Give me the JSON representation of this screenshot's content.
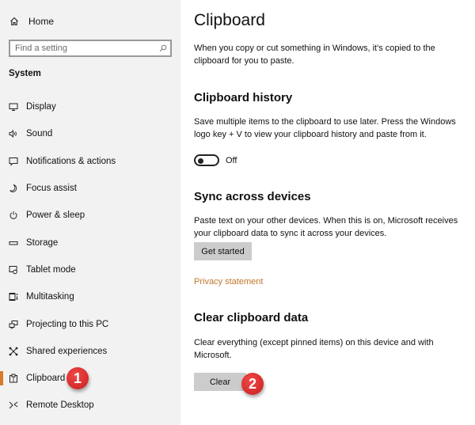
{
  "sidebar": {
    "home_label": "Home",
    "search_placeholder": "Find a setting",
    "section_label": "System",
    "items": [
      {
        "label": "Display",
        "icon": "display-icon"
      },
      {
        "label": "Sound",
        "icon": "sound-icon"
      },
      {
        "label": "Notifications & actions",
        "icon": "notifications-icon"
      },
      {
        "label": "Focus assist",
        "icon": "moon-icon"
      },
      {
        "label": "Power & sleep",
        "icon": "power-icon"
      },
      {
        "label": "Storage",
        "icon": "storage-icon"
      },
      {
        "label": "Tablet mode",
        "icon": "tablet-mode-icon"
      },
      {
        "label": "Multitasking",
        "icon": "multitasking-icon"
      },
      {
        "label": "Projecting to this PC",
        "icon": "projecting-icon"
      },
      {
        "label": "Shared experiences",
        "icon": "shared-experiences-icon"
      },
      {
        "label": "Clipboard",
        "icon": "clipboard-icon",
        "active": true
      },
      {
        "label": "Remote Desktop",
        "icon": "remote-desktop-icon"
      }
    ],
    "accent_color": "#d87a26"
  },
  "main": {
    "title": "Clipboard",
    "intro": "When you copy or cut something in Windows, it's copied to the clipboard for you to paste.",
    "history": {
      "heading": "Clipboard history",
      "description": "Save multiple items to the clipboard to use later. Press the Windows logo key + V to view your clipboard history and paste from it.",
      "toggle_state": "Off"
    },
    "sync": {
      "heading": "Sync across devices",
      "description": "Paste text on your other devices. When this is on, Microsoft receives your clipboard data to sync it across your devices.",
      "button_label": "Get started",
      "privacy_link": "Privacy statement"
    },
    "clear": {
      "heading": "Clear clipboard data",
      "description": "Clear everything (except pinned items) on this device and with Microsoft.",
      "button_label": "Clear"
    }
  },
  "annotations": {
    "badge_1": "1",
    "badge_2": "2",
    "badge_color": "#d42b2b"
  }
}
